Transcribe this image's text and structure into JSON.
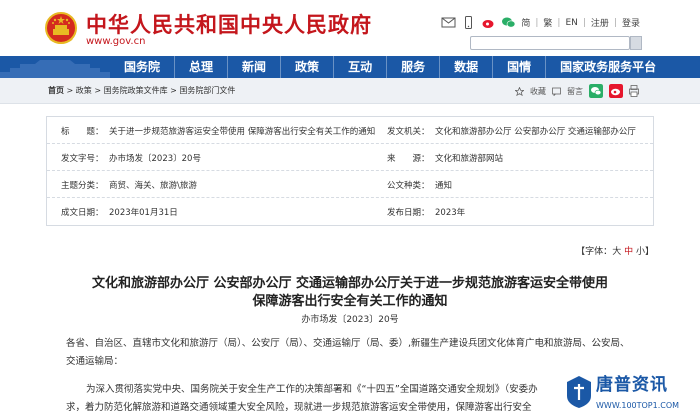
{
  "header": {
    "site_title": "中华人民共和国中央人民政府",
    "site_url": "www.gov.cn",
    "tools": [
      "简",
      "繁",
      "EN",
      "注册",
      "登录"
    ]
  },
  "nav": {
    "items": [
      "国务院",
      "总理",
      "新闻",
      "政策",
      "互动",
      "服务",
      "数据",
      "国情",
      "国家政务服务平台"
    ]
  },
  "breadcrumb": {
    "items": [
      "首页",
      "政策",
      "国务院政策文件库",
      "国务院部门文件"
    ],
    "sep": " > "
  },
  "share": {
    "collect": "收藏",
    "message": "留言"
  },
  "meta": {
    "title_key": "标　　题：",
    "title_val_line1": "关于进一步规范旅游客运安全带使用 保障游客出行安全有关工作的通知",
    "issuer_key": "发文机关：",
    "issuer_val": "文化和旅游部办公厅  公安部办公厅  交通运输部办公厅",
    "docno_key": "发文字号：",
    "docno_val": "办市场发〔2023〕20号",
    "source_key": "来　　源：",
    "source_val": "文化和旅游部网站",
    "topic_key": "主题分类：",
    "topic_val": "商贸、海关、旅游\\旅游",
    "type_key": "公文种类：",
    "type_val": "通知",
    "date_key": "成文日期：",
    "date_val": "2023年01月31日",
    "pub_key": "发布日期：",
    "pub_val": "2023年"
  },
  "font_size": {
    "prefix": "【字体：",
    "large": "大",
    "mid": "中",
    "small": "小",
    "suffix": "】"
  },
  "article": {
    "title_line1": "文化和旅游部办公厅  公安部办公厅  交通运输部办公厅关于进一步规范旅游客运安全带使用",
    "title_line2": "保障游客出行安全有关工作的通知",
    "doc_no": "办市场发〔2023〕20号",
    "para1_line1": "各省、自治区、直辖市文化和旅游厅（局）、公安厅（局）、交通运输厅（局、委）,新疆生产建设兵团文化体育广电和旅游局、公安局、",
    "para1_line2": "交通运输局：",
    "para2_line1": "为深入贯彻落实党中央、国务院关于安全生产工作的决策部署和《“十四五”全国道路交通安全规划》（安委办",
    "para2_line2": "求，着力防范化解旅游和道路交通领域重大安全风险，现就进一步规范旅游客运安全带使用，保障游客出行安全"
  },
  "watermark": {
    "text": "唐普资讯",
    "url": "WWW.100TOP1.COM"
  }
}
